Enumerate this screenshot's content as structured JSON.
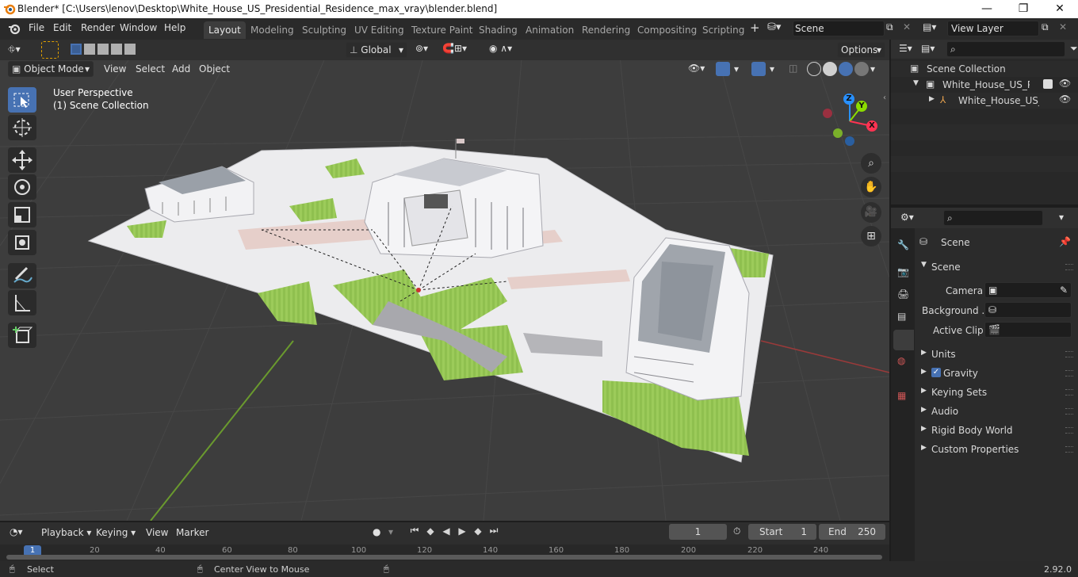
{
  "window": {
    "title": "Blender* [C:\\Users\\lenov\\Desktop\\White_House_US_Presidential_Residence_max_vray\\blender.blend]",
    "minimize": "—",
    "maximize": "❐",
    "close": "✕"
  },
  "menu": {
    "items": [
      "File",
      "Edit",
      "Render",
      "Window",
      "Help"
    ]
  },
  "workspaces": {
    "tabs": [
      "Layout",
      "Modeling",
      "Sculpting",
      "UV Editing",
      "Texture Paint",
      "Shading",
      "Animation",
      "Rendering",
      "Compositing",
      "Scripting"
    ],
    "active": "Layout"
  },
  "scene_selector": {
    "value": "Scene"
  },
  "view_layer": {
    "value": "View Layer"
  },
  "viewport_header": {
    "transform_orientation": "Global",
    "options": "Options",
    "mode": "Object Mode",
    "menus": [
      "View",
      "Select",
      "Add",
      "Object"
    ]
  },
  "viewport": {
    "line1": "User Perspective",
    "line2": "(1) Scene Collection"
  },
  "gizmo": {
    "z": "Z",
    "y": "Y",
    "x": "X"
  },
  "outliner": {
    "root": "Scene Collection",
    "items": [
      "White_House_US_Preside",
      "White_House_US_Pre"
    ]
  },
  "properties": {
    "header": "Scene",
    "panel": "Scene",
    "camera_label": "Camera",
    "background_label": "Background ...",
    "active_clip_label": "Active Clip",
    "sections": [
      "Units",
      "Gravity",
      "Keying Sets",
      "Audio",
      "Rigid Body World",
      "Custom Properties"
    ]
  },
  "timeline": {
    "menus": [
      "Playback",
      "Keying",
      "View",
      "Marker"
    ],
    "current_frame": "1",
    "start_label": "Start",
    "start": "1",
    "end_label": "End",
    "end": "250",
    "ruler": [
      "1",
      "20",
      "40",
      "60",
      "80",
      "100",
      "120",
      "140",
      "160",
      "180",
      "200",
      "220",
      "240"
    ]
  },
  "statusbar": {
    "left": "Select",
    "middle": "Center View to Mouse",
    "version": "2.92.0"
  },
  "colors": {
    "accent": "#4772b3",
    "grass": "#8fc04f",
    "axis_x": "#ff3352",
    "axis_y": "#8bdc00",
    "axis_z": "#2890ff"
  }
}
